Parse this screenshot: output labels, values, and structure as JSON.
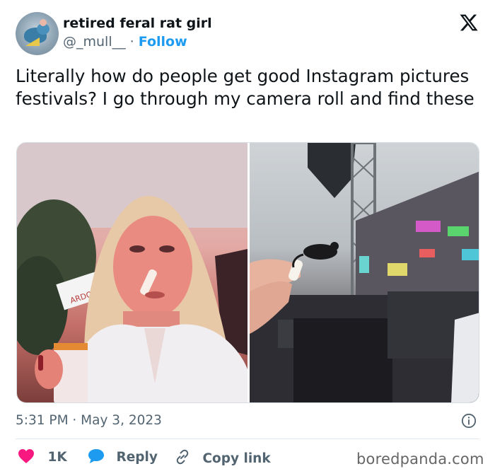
{
  "author": {
    "display_name": "retired feral rat girl",
    "handle": "@_mull__",
    "separator": "·",
    "follow_label": "Follow"
  },
  "tweet": {
    "text": "Literally how do people get good Instagram pictures festivals? I go through my camera roll and find these"
  },
  "media": {
    "left_photo": {
      "banner_text": "ARDOYBEACH"
    },
    "count": 2
  },
  "meta": {
    "timestamp": "5:31 PM · May 3, 2023"
  },
  "actions": {
    "like_count": "1K",
    "reply_label": "Reply",
    "copy_label": "Copy link"
  },
  "watermark": "boredpanda.com",
  "icons": {
    "logo": "x-logo-icon",
    "info": "info-icon",
    "like": "heart-icon",
    "reply": "speech-bubble-icon",
    "copy": "link-icon"
  },
  "colors": {
    "accent": "#1d9bf0",
    "like": "#f91880",
    "text": "#0f1419",
    "secondary": "#536471"
  }
}
